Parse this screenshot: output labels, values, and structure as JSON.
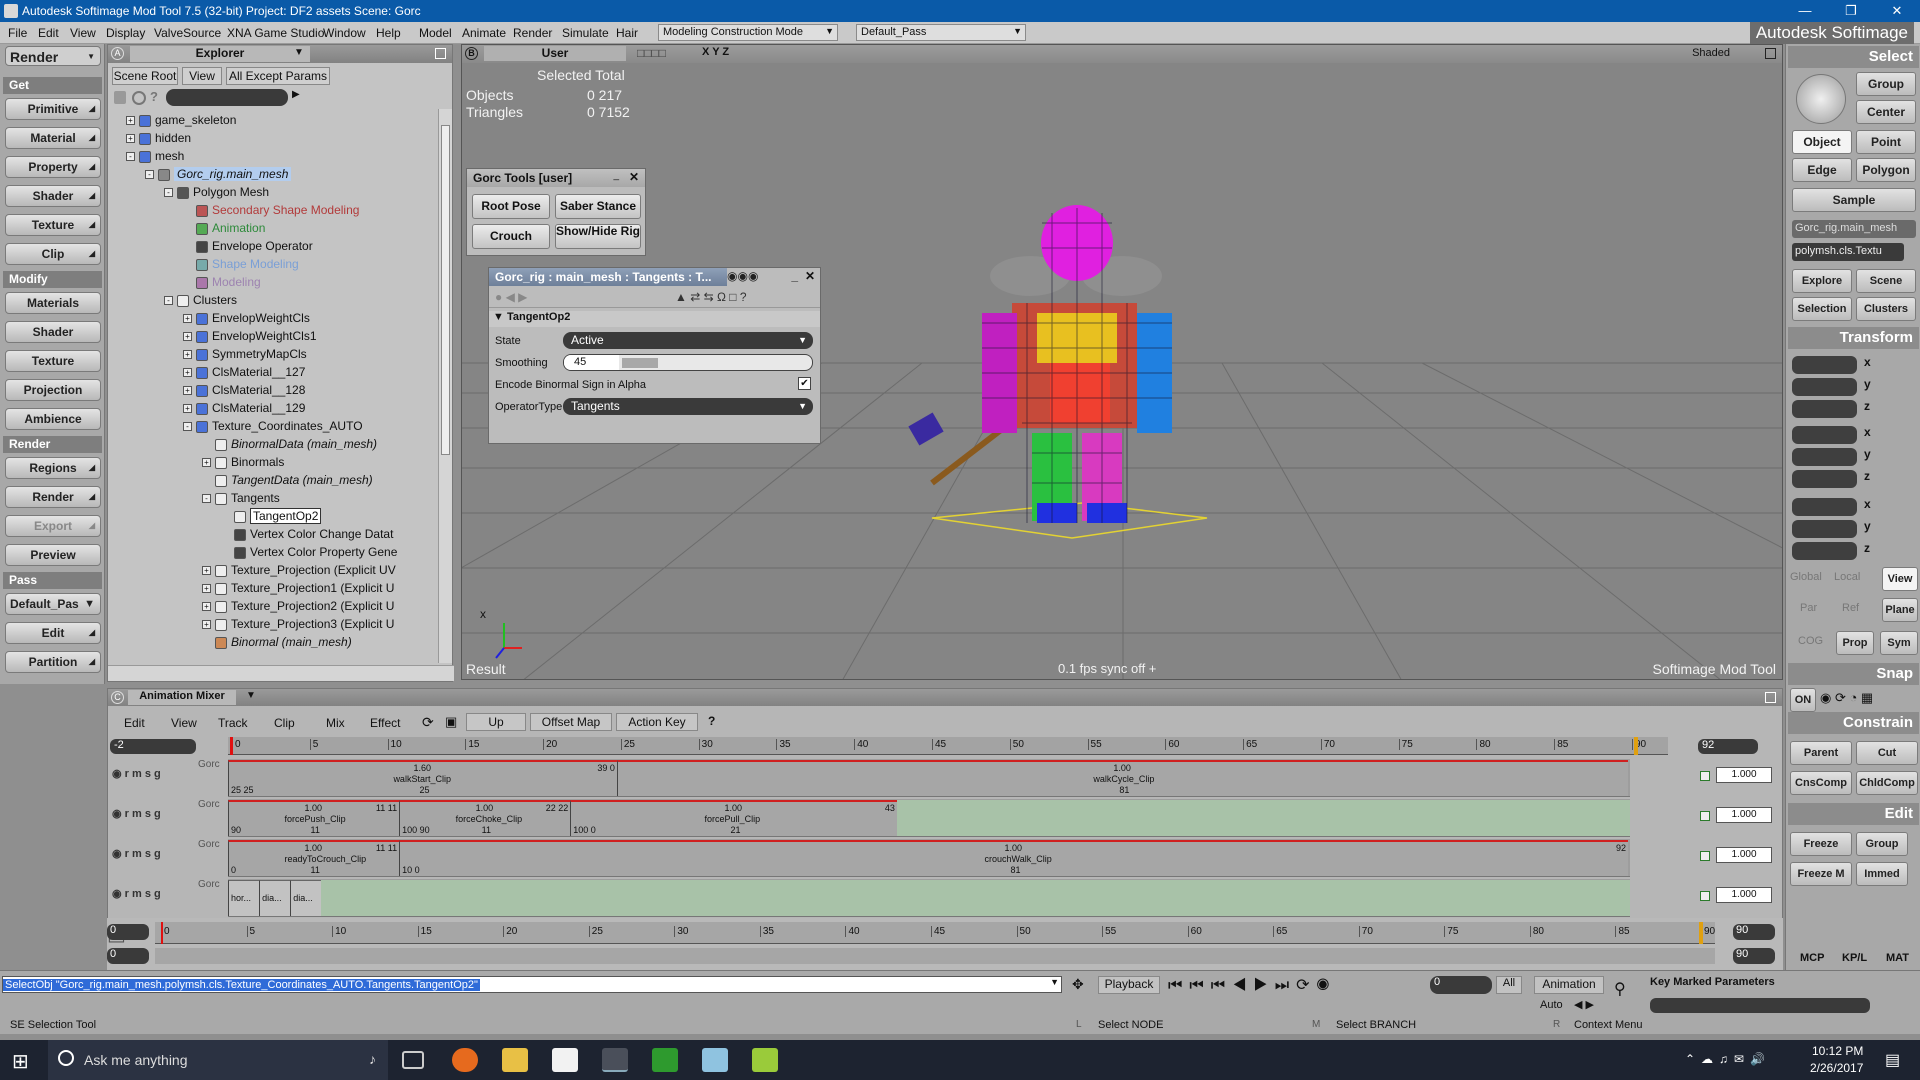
{
  "window": {
    "title": "Autodesk Softimage Mod Tool 7.5 (32-bit)    Project: DF2 assets    Scene: Gorc",
    "brand": "Autodesk Softimage"
  },
  "menu": [
    "File",
    "Edit",
    "View",
    "Display",
    "ValveSource",
    "XNA Game Studio",
    "Window",
    "Help",
    "Model",
    "Animate",
    "Render",
    "Simulate",
    "Hair"
  ],
  "mode_combo": "Modeling Construction Mode",
  "pass_combo": "Default_Pass",
  "left_panel": {
    "render_label": "Render",
    "get": "Get",
    "modify": "Modify",
    "render": "Render",
    "pass": "Pass",
    "get_items": [
      "Primitive",
      "Material",
      "Property",
      "Shader",
      "Texture",
      "Clip"
    ],
    "modify_items": [
      "Materials",
      "Shader",
      "Texture",
      "Projection",
      "Ambience"
    ],
    "render_items": [
      "Regions",
      "Render",
      "Export",
      "Preview"
    ],
    "pass_combo": "Default_Pas",
    "pass_items": [
      "Edit",
      "Partition"
    ]
  },
  "explorer": {
    "title": "Explorer",
    "scene_root": "Scene Root",
    "view": "View",
    "filter": "All Except Params",
    "rows": [
      {
        "label": "game_skeleton",
        "indent": 0,
        "exp": "+",
        "color": "#4a72d8"
      },
      {
        "label": "hidden",
        "indent": 0,
        "exp": "+",
        "color": "#4a72d8"
      },
      {
        "label": "mesh",
        "indent": 0,
        "exp": "-",
        "color": "#4a72d8"
      },
      {
        "label": "Gorc_rig.main_mesh",
        "indent": 1,
        "exp": "-",
        "color": "#888",
        "italic": true,
        "sel": true
      },
      {
        "label": "Polygon Mesh",
        "indent": 2,
        "exp": "-",
        "color": "#555"
      },
      {
        "label": "Secondary Shape Modeling",
        "indent": 3,
        "exp": "",
        "color": "#b55",
        "tcolor": "#b23a3a"
      },
      {
        "label": "Animation",
        "indent": 3,
        "exp": "",
        "color": "#5a5",
        "tcolor": "#2d8a3a"
      },
      {
        "label": "Envelope Operator",
        "indent": 3,
        "exp": "",
        "color": "#444"
      },
      {
        "label": "Shape Modeling",
        "indent": 3,
        "exp": "",
        "color": "#7aa",
        "tcolor": "#7a9fd6"
      },
      {
        "label": "Modeling",
        "indent": 3,
        "exp": "",
        "color": "#a7a",
        "tcolor": "#9d83b0"
      },
      {
        "label": "Clusters",
        "indent": 2,
        "exp": "-",
        "color": "#eee"
      },
      {
        "label": "EnvelopWeightCls",
        "indent": 3,
        "exp": "+",
        "color": "#4a72d8"
      },
      {
        "label": "EnvelopWeightCls1",
        "indent": 3,
        "exp": "+",
        "color": "#4a72d8"
      },
      {
        "label": "SymmetryMapCls",
        "indent": 3,
        "exp": "+",
        "color": "#4a72d8"
      },
      {
        "label": "ClsMaterial__127",
        "indent": 3,
        "exp": "+",
        "color": "#4a72d8"
      },
      {
        "label": "ClsMaterial__128",
        "indent": 3,
        "exp": "+",
        "color": "#4a72d8"
      },
      {
        "label": "ClsMaterial__129",
        "indent": 3,
        "exp": "+",
        "color": "#4a72d8"
      },
      {
        "label": "Texture_Coordinates_AUTO",
        "indent": 3,
        "exp": "-",
        "color": "#4a72d8"
      },
      {
        "label": "BinormalData (main_mesh)",
        "indent": 4,
        "exp": "",
        "color": "#eee",
        "italic": true
      },
      {
        "label": "Binormals",
        "indent": 4,
        "exp": "+",
        "color": "#eee"
      },
      {
        "label": "TangentData (main_mesh)",
        "indent": 4,
        "exp": "",
        "color": "#eee",
        "italic": true
      },
      {
        "label": "Tangents",
        "indent": 4,
        "exp": "-",
        "color": "#eee"
      },
      {
        "label": "TangentOp2",
        "indent": 5,
        "exp": "",
        "color": "#eee",
        "boxed": true
      },
      {
        "label": "Vertex Color Change Datat",
        "indent": 5,
        "exp": "",
        "color": "#444"
      },
      {
        "label": "Vertex Color Property Gene",
        "indent": 5,
        "exp": "",
        "color": "#444"
      },
      {
        "label": "Texture_Projection (Explicit UV",
        "indent": 4,
        "exp": "+",
        "color": "#eee"
      },
      {
        "label": "Texture_Projection1 (Explicit U",
        "indent": 4,
        "exp": "+",
        "color": "#eee"
      },
      {
        "label": "Texture_Projection2 (Explicit U",
        "indent": 4,
        "exp": "+",
        "color": "#eee"
      },
      {
        "label": "Texture_Projection3 (Explicit U",
        "indent": 4,
        "exp": "+",
        "color": "#eee"
      },
      {
        "label": "Binormal (main_mesh)",
        "indent": 4,
        "exp": "",
        "color": "#c85",
        "italic": true
      }
    ]
  },
  "viewport": {
    "camera": "User",
    "shading": "Shaded",
    "axes": "X Y Z",
    "stats_title": "Selected  Total",
    "objects": "Objects",
    "objects_vals": "0   217",
    "triangles": "Triangles",
    "triangles_vals": "0  7152",
    "result": "Result",
    "fps": "0.1 fps  sync off  +",
    "footer": "Softimage Mod Tool"
  },
  "gorc_tools": {
    "title": "Gorc Tools [user]",
    "buttons": [
      "Root Pose",
      "Saber Stance",
      "Crouch",
      "Show/Hide Rig"
    ]
  },
  "ppg": {
    "title": "Gorc_rig : main_mesh : Tangents : T...",
    "section": "TangentOp2",
    "state_label": "State",
    "state_value": "Active",
    "smoothing_label": "Smoothing",
    "smoothing_value": "45",
    "smoothing_fraction": 0.45,
    "encode_label": "Encode Binormal Sign in Alpha",
    "optype_label": "OperatorType",
    "optype_value": "Tangents"
  },
  "right_panel": {
    "select": "Select",
    "select_btns": [
      "Group",
      "Center",
      "Object",
      "Point",
      "Edge",
      "Polygon",
      "Sample"
    ],
    "obj_field": "Gorc_rig.main_mesh",
    "cls_field": "polymsh.cls.Textu",
    "explore_btns": [
      "Explore",
      "Scene",
      "Selection",
      "Clusters"
    ],
    "transform": "Transform",
    "xyz": [
      "x",
      "y",
      "z"
    ],
    "coord_btns": [
      "Global",
      "Local",
      "View",
      "Par",
      "Ref",
      "Plane",
      "COG",
      "Prop",
      "Sym"
    ],
    "snap": "Snap",
    "snap_on": "ON",
    "constrain": "Constrain",
    "constrain_btns": [
      "Parent",
      "Cut",
      "CnsComp",
      "ChldComp"
    ],
    "edit": "Edit",
    "edit_btns": [
      "Freeze",
      "Group",
      "Freeze M",
      "Immed"
    ],
    "tabs": [
      "MCP",
      "KP/L",
      "MAT"
    ]
  },
  "mixer": {
    "title": "Animation Mixer",
    "menus": [
      "Edit",
      "View",
      "Track",
      "Clip",
      "Mix",
      "Effect"
    ],
    "buttons": [
      "Up",
      "Offset Map",
      "Action Key"
    ],
    "start": "-2",
    "end": "92",
    "ruler": [
      "0",
      "5",
      "10",
      "15",
      "20",
      "25",
      "30",
      "35",
      "40",
      "45",
      "50",
      "55",
      "60",
      "65",
      "70",
      "75",
      "80",
      "85",
      "90"
    ],
    "track_label": "Gorc",
    "track_weight": "1.000",
    "tracks": [
      {
        "clips": [
          {
            "name": "walkStart_Clip",
            "start": 0,
            "end": 25,
            "top": "1.60",
            "mid": "25",
            "bot": "25 25",
            "bot2": "39 0"
          },
          {
            "name": "walkCycle_Clip",
            "start": 25,
            "end": 90,
            "top": "1.00",
            "mid": "81",
            "bot": "",
            "bot2": ""
          }
        ]
      },
      {
        "clips": [
          {
            "name": "forcePush_Clip",
            "start": 0,
            "end": 11,
            "top": "1.00",
            "mid": "11",
            "bot": "90",
            "bot2": "11 11"
          },
          {
            "name": "forceChoke_Clip",
            "start": 11,
            "end": 22,
            "top": "1.00",
            "mid": "11",
            "bot": "100 90",
            "bot2": "22 22"
          },
          {
            "name": "forcePull_Clip",
            "start": 22,
            "end": 43,
            "top": "1.00",
            "mid": "21",
            "bot": "100 0",
            "bot2": "43"
          }
        ]
      },
      {
        "clips": [
          {
            "name": "readyToCrouch_Clip",
            "start": 0,
            "end": 11,
            "top": "1.00",
            "mid": "11",
            "bot": "0",
            "bot2": "11 11"
          },
          {
            "name": "crouchWalk_Clip",
            "start": 11,
            "end": 90,
            "top": "1.00",
            "mid": "81",
            "bot": "10 0",
            "bot2": "92"
          }
        ]
      },
      {
        "clips": [
          {
            "name": "hor...",
            "start": 0,
            "end": 2
          },
          {
            "name": "dia...",
            "start": 2,
            "end": 4
          },
          {
            "name": "dia...",
            "start": 4,
            "end": 6
          }
        ]
      }
    ]
  },
  "timeline": {
    "start": "0",
    "end": "90",
    "current": "0",
    "ruler": [
      "0",
      "5",
      "10",
      "15",
      "20",
      "25",
      "30",
      "35",
      "40",
      "45",
      "50",
      "55",
      "60",
      "65",
      "70",
      "75",
      "80",
      "85",
      "90"
    ]
  },
  "bottom": {
    "command": "SelectObj \"Gorc_rig.main_mesh.polymsh.cls.Texture_Coordinates_AUTO.Tangents.TangentOp2\"",
    "playback": "Playback",
    "frame": "0",
    "all": "All",
    "animation": "Animation",
    "auto": "Auto",
    "keyparams": "Key Marked Parameters",
    "status": "SE Selection Tool",
    "lmb": "L",
    "lmb_text": "Select NODE",
    "mmb": "M",
    "mmb_text": "Select BRANCH",
    "rmb": "R",
    "rmb_text": "Context Menu"
  },
  "taskbar": {
    "search": "Ask me anything",
    "time": "10:12 PM",
    "date": "2/26/2017"
  }
}
